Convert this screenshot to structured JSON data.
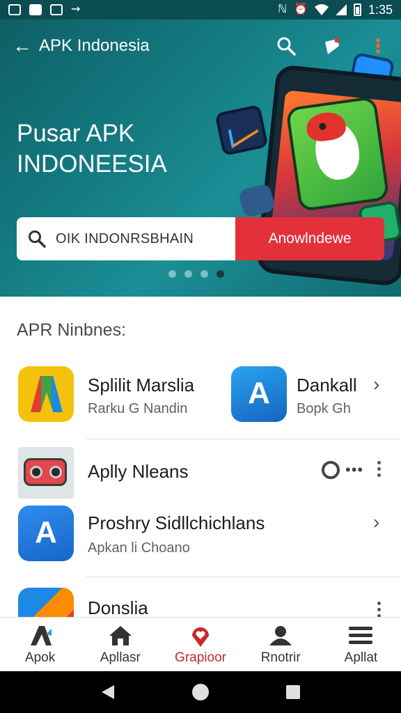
{
  "status_bar": {
    "time": "1:35",
    "left_icons": [
      "gallery-icon",
      "bag-icon",
      "calendar-icon",
      "cast-icon"
    ],
    "right_icons": [
      "nfc-icon",
      "alarm-icon",
      "wifi-icon",
      "signal-icon",
      "battery-icon"
    ]
  },
  "app_bar": {
    "title": "APK Indonesia",
    "back_icon": "arrow-left-icon",
    "actions": [
      "search-icon",
      "notification-tag-icon",
      "more-vert-icon"
    ],
    "accent": "#e2313b"
  },
  "banner": {
    "title_line1": "Pusar APK",
    "title_line2": "INDONEESIA",
    "search_text": "OIK INDONRSBHAIN",
    "button_label": "Anowlndewe",
    "slides": 4,
    "active_slide": 4
  },
  "section": {
    "title": "APR Ninbnes:"
  },
  "apps": [
    {
      "title": "Splilit Marslia",
      "subtitle": "Rarku G Nandin",
      "icon": "multicolor-a-icon"
    },
    {
      "title": "Dankall",
      "subtitle": "Bopk Gh",
      "icon": "blue-a-icon"
    },
    {
      "title": "Aplly Nleans",
      "subtitle": "",
      "icon": "radio-icon"
    },
    {
      "title": "Proshry Sidllchichlans",
      "subtitle": "Apkan li Choano",
      "icon": "blue-a-icon"
    },
    {
      "title": "Donslia",
      "subtitle": "",
      "icon": "colorful-a-icon"
    }
  ],
  "bottom_nav": [
    {
      "label": "Apok",
      "icon": "a-logo-icon"
    },
    {
      "label": "Apllasr",
      "icon": "home-icon"
    },
    {
      "label": "Grapioor",
      "icon": "heart-pin-icon",
      "color": "#c62828"
    },
    {
      "label": "Rnotrir",
      "icon": "person-icon"
    },
    {
      "label": "Apllat",
      "icon": "menu-icon"
    }
  ],
  "system_nav": [
    "back-triangle-icon",
    "home-circle-icon",
    "recents-square-icon"
  ]
}
